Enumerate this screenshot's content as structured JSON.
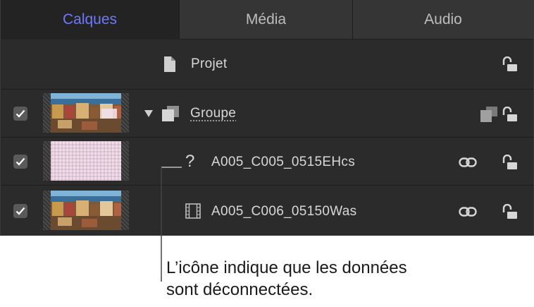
{
  "tabs": [
    {
      "label": "Calques",
      "active": true
    },
    {
      "label": "Média",
      "active": false
    },
    {
      "label": "Audio",
      "active": false
    }
  ],
  "rows": {
    "project": {
      "label": "Projet"
    },
    "group": {
      "label": "Groupe"
    },
    "clip1": {
      "label": "A005_C005_0515EHcs",
      "status_glyph": "?"
    },
    "clip2": {
      "label": "A005_C006_05150Was"
    }
  },
  "callout": {
    "line1": "L’icône indique que les données",
    "line2": "sont déconnectées."
  },
  "colors": {
    "active_tab_text": "#6e78ff",
    "panel_bg": "#2b2b2b"
  },
  "icons": [
    "document-icon",
    "lock-icon",
    "disclosure-triangle-icon",
    "group-icon",
    "stack-icon",
    "missing-media-icon",
    "link-icon",
    "film-icon",
    "checkmark-icon"
  ]
}
